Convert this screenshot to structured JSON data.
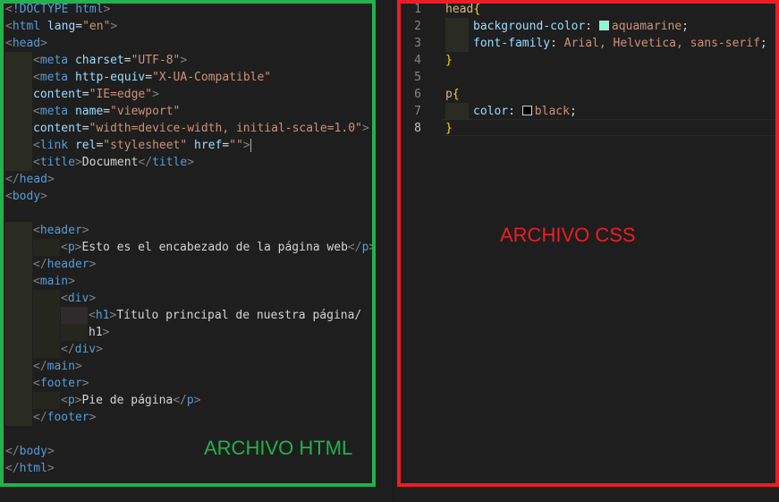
{
  "html_editor": {
    "lines": [
      {
        "t": "<!DOCTYPE html>"
      },
      {
        "t": "<html lang=\"en\">"
      },
      {
        "t": "<head>"
      },
      {
        "t": "    <meta charset=\"UTF-8\">"
      },
      {
        "t": "    <meta http-equiv=\"X-UA-Compatible\""
      },
      {
        "t": "    content=\"IE=edge\">"
      },
      {
        "t": "    <meta name=\"viewport\""
      },
      {
        "t": "    content=\"width=device-width, initial-scale=1.0\">"
      },
      {
        "t": "    <link rel=\"stylesheet\" href=\"\">"
      },
      {
        "t": "    <title>Document</title>"
      },
      {
        "t": "</head>"
      },
      {
        "t": "<body>"
      },
      {
        "t": ""
      },
      {
        "t": "    <header>"
      },
      {
        "t": "        <p>Esto es el encabezado de la página web</p>"
      },
      {
        "t": "    </header>"
      },
      {
        "t": "    <main>"
      },
      {
        "t": "        <div>"
      },
      {
        "t": "            <h1>Título principal de nuestra página</"
      },
      {
        "t": "            h1>"
      },
      {
        "t": "        </div>"
      },
      {
        "t": "    </main>"
      },
      {
        "t": "    <footer>"
      },
      {
        "t": "        <p>Pie de página</p>"
      },
      {
        "t": "    </footer>"
      },
      {
        "t": ""
      },
      {
        "t": "</body>"
      },
      {
        "t": "</html>"
      }
    ],
    "label": "ARCHIVO HTML"
  },
  "css_editor": {
    "line_numbers": [
      "1",
      "2",
      "3",
      "4",
      "5",
      "6",
      "7",
      "8"
    ],
    "active_line": "8",
    "label": "ARCHIVO CSS",
    "l1_selector": "head",
    "l1_brace": "{",
    "l2_prop": "background-color",
    "l2_value": "aquamarine",
    "l3_prop": "font-family",
    "l3_value": "Arial, Helvetica, sans-serif",
    "l4_brace": "}",
    "l6_selector": "p",
    "l6_brace": "{",
    "l7_prop": "color",
    "l7_value": "black",
    "l8_brace": "}",
    "colon": ":",
    "semicolon": ";",
    "swatch_colors": {
      "aquamarine": "#7fffd4",
      "black": "#000000"
    }
  },
  "colors": {
    "html_frame": "#22b14c",
    "css_frame": "#ed1c24"
  }
}
